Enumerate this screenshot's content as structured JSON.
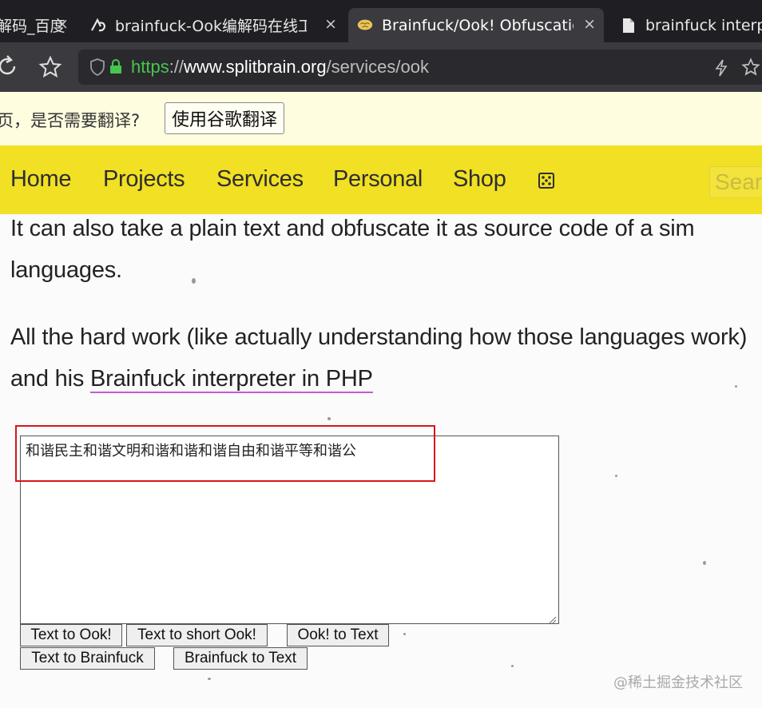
{
  "browser": {
    "tabs": [
      {
        "title": "解码_百度",
        "close": "×"
      },
      {
        "title": "brainfuck-Ook编解码在线工具",
        "close": "×"
      },
      {
        "title": "Brainfuck/Ook! Obfuscation",
        "close": "×",
        "active": true
      },
      {
        "title": "brainfuck interpreter",
        "close": ""
      }
    ],
    "url": {
      "scheme": "https",
      "sep": "://",
      "host": "www.splitbrain.org",
      "path": "/services/ook"
    }
  },
  "translate_bar": {
    "prompt": "页，是否需要翻译?",
    "button_label": "使用谷歌翻译"
  },
  "site_nav": {
    "items": [
      "Home",
      "Projects",
      "Services",
      "Personal",
      "Shop"
    ],
    "random_icon": "dice-icon",
    "search_placeholder": "Search"
  },
  "content": {
    "line1": "It can also take a plain text and obfuscate it as source code of a simple program of the above languages.",
    "line1a": "It can also take a plain text and obfuscate it as source code of a sim",
    "line1b": "languages.",
    "line2a": "All the hard work (like actually understanding how those languages work)",
    "line2b_prefix": "and his ",
    "line2b_link": "Brainfuck interpreter in PHP"
  },
  "converter": {
    "input_value": "和谐民主和谐文明和谐和谐和谐自由和谐平等和谐公",
    "buttons_row1": [
      "Text to Ook!",
      "Text to short Ook!",
      "Ook! to Text"
    ],
    "buttons_row2": [
      "Text to Brainfuck",
      "Brainfuck to Text"
    ]
  },
  "watermark": "@稀土掘金技术社区",
  "colors": {
    "nav_yellow": "#f1e023",
    "highlight_red": "#d8161c",
    "secure_green": "#46c64c",
    "link_underline": "#c45cd6"
  }
}
